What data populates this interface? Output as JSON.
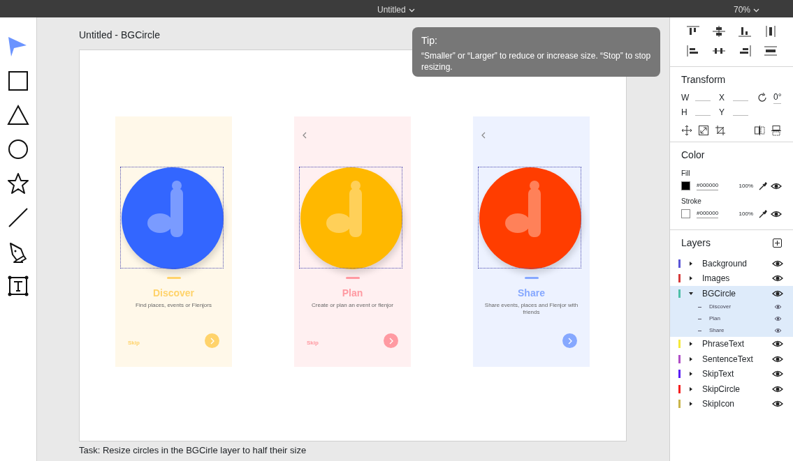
{
  "top_bar": {
    "title": "Untitled",
    "zoom": "70%"
  },
  "tools": [
    {
      "kind": "select",
      "selected": true
    },
    {
      "kind": "rectangle",
      "selected": false
    },
    {
      "kind": "triangle",
      "selected": false
    },
    {
      "kind": "ellipse",
      "selected": false
    },
    {
      "kind": "star",
      "selected": false
    },
    {
      "kind": "line",
      "selected": false
    },
    {
      "kind": "pen",
      "selected": false
    },
    {
      "kind": "text",
      "selected": false
    }
  ],
  "canvas": {
    "title": "Untitled - BGCircle",
    "screens": [
      {
        "title": "Discover",
        "subtitle": "Find places, events or Flenjors",
        "skip": "Skip",
        "back": false,
        "color": "#ffd36b",
        "circle": {
          "color": "#3366ff",
          "selected": true
        }
      },
      {
        "title": "Plan",
        "subtitle": "Create or plan an event or flenjor",
        "skip": "Skip",
        "back": true,
        "color": "#ff9aa2",
        "circle": {
          "color": "#ffb800",
          "selected": true
        }
      },
      {
        "title": "Share",
        "subtitle": "Share events, places and Flenjor with friends",
        "back": true,
        "color": "#86a8ff",
        "circle": {
          "color": "#ff3d00",
          "selected": true
        }
      }
    ],
    "task": "Task: Resize circles in the BGCirle layer to half their size"
  },
  "tip": {
    "title": "Tip:",
    "text": "“Smaller” or “Larger” to reduce or increase size. “Stop” to stop resizing."
  },
  "transform": {
    "title": "Transform",
    "fields": [
      {
        "label": "W"
      },
      {
        "label": "X"
      },
      {
        "label": "H"
      },
      {
        "label": "Y"
      }
    ],
    "rotation": "0°"
  },
  "color_panel": {
    "title": "Color",
    "rows": [
      {
        "kind": "fill",
        "label": "Fill",
        "value": "#000000",
        "opacity": "100%"
      },
      {
        "kind": "stroke",
        "label": "Stroke",
        "value": "#000000",
        "opacity": "100%"
      }
    ]
  },
  "layers": {
    "title": "Layers",
    "items": [
      {
        "name": "Background",
        "color": "#5a55d6",
        "expanded": false,
        "selected": false
      },
      {
        "name": "Images",
        "color": "#d63a3a",
        "expanded": false,
        "selected": false
      },
      {
        "name": "BGCircle",
        "color": "#4fbfa8",
        "expanded": true,
        "selected": true,
        "children": [
          {
            "name": "Discover"
          },
          {
            "name": "Plan"
          },
          {
            "name": "Share"
          }
        ]
      },
      {
        "name": "PhraseText",
        "color": "#f5e93a",
        "expanded": false,
        "selected": false
      },
      {
        "name": "SentenceText",
        "color": "#b04fc7",
        "expanded": false,
        "selected": false
      },
      {
        "name": "SkipText",
        "color": "#5a1ef5",
        "expanded": false,
        "selected": false
      },
      {
        "name": "SkipCircle",
        "color": "#f51e1e",
        "expanded": false,
        "selected": false
      },
      {
        "name": "SkipIcon",
        "color": "#c9b44a",
        "expanded": false,
        "selected": false
      }
    ]
  }
}
